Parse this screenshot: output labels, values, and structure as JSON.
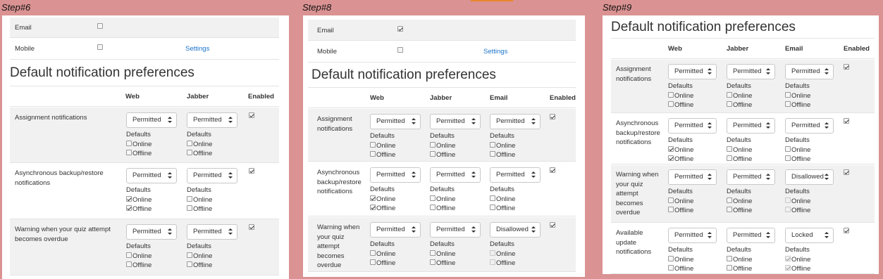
{
  "steps": [
    "Step#6",
    "Step#8",
    "Step#9"
  ],
  "section_title": "Default notification preferences",
  "headers": {
    "web": "Web",
    "jabber": "Jabber",
    "email": "Email",
    "enabled": "Enabled"
  },
  "defaults_label": "Defaults",
  "online_label": "Online",
  "offline_label": "Offline",
  "settings_link": "Settings",
  "processors": {
    "email": "Email",
    "mobile": "Mobile"
  },
  "panel6": {
    "email_checked": false,
    "mobile_checked": false,
    "rows": [
      {
        "label": "Assignment notifications",
        "web": "Permitted",
        "jabber": "Permitted",
        "enabled": true,
        "web_online": false,
        "web_offline": false,
        "jabber_online": false,
        "jabber_offline": false
      },
      {
        "label": "Asynchronous backup/restore notifications",
        "web": "Permitted",
        "jabber": "Permitted",
        "enabled": true,
        "web_online": true,
        "web_offline": true,
        "jabber_online": false,
        "jabber_offline": false
      },
      {
        "label": "Warning when your quiz attempt becomes overdue",
        "web": "Permitted",
        "jabber": "Permitted",
        "enabled": true,
        "web_online": false,
        "web_offline": false,
        "jabber_online": false,
        "jabber_offline": false
      }
    ]
  },
  "panel8": {
    "email_checked": true,
    "mobile_checked": false,
    "rows": [
      {
        "label": "Assignment notifications",
        "web": "Permitted",
        "jabber": "Permitted",
        "email": "Permitted",
        "enabled": true,
        "web_online": false,
        "web_offline": false,
        "jabber_online": false,
        "jabber_offline": false,
        "email_online": false,
        "email_offline": false
      },
      {
        "label": "Asynchronous backup/restore notifications",
        "web": "Permitted",
        "jabber": "Permitted",
        "email": "Permitted",
        "enabled": true,
        "web_online": true,
        "web_offline": true,
        "jabber_online": false,
        "jabber_offline": false,
        "email_online": false,
        "email_offline": false
      },
      {
        "label": "Warning when your quiz attempt becomes overdue",
        "web": "Permitted",
        "jabber": "Permitted",
        "email": "Disallowed",
        "enabled": true,
        "web_online": false,
        "web_offline": false,
        "jabber_online": false,
        "jabber_offline": false,
        "email_online": false,
        "email_offline": false,
        "email_disabled": true
      }
    ]
  },
  "panel9": {
    "rows": [
      {
        "label": "Assignment notifications",
        "web": "Permitted",
        "jabber": "Permitted",
        "email": "Permitted",
        "enabled": true,
        "web_online": false,
        "web_offline": false,
        "jabber_online": false,
        "jabber_offline": false,
        "email_online": false,
        "email_offline": false
      },
      {
        "label": "Asynchronous backup/restore notifications",
        "web": "Permitted",
        "jabber": "Permitted",
        "email": "Permitted",
        "enabled": true,
        "web_online": true,
        "web_offline": true,
        "jabber_online": false,
        "jabber_offline": false,
        "email_online": false,
        "email_offline": false
      },
      {
        "label": "Warning when your quiz attempt becomes overdue",
        "web": "Permitted",
        "jabber": "Permitted",
        "email": "Disallowed",
        "enabled": true,
        "web_online": false,
        "web_offline": false,
        "jabber_online": false,
        "jabber_offline": false,
        "email_online": false,
        "email_offline": false,
        "email_disabled": true
      },
      {
        "label": "Available update notifications",
        "web": "Permitted",
        "jabber": "Permitted",
        "email": "Locked",
        "enabled": true,
        "web_online": false,
        "web_offline": false,
        "jabber_online": false,
        "jabber_offline": false,
        "email_online": true,
        "email_offline": true,
        "email_disabled": true
      }
    ]
  }
}
